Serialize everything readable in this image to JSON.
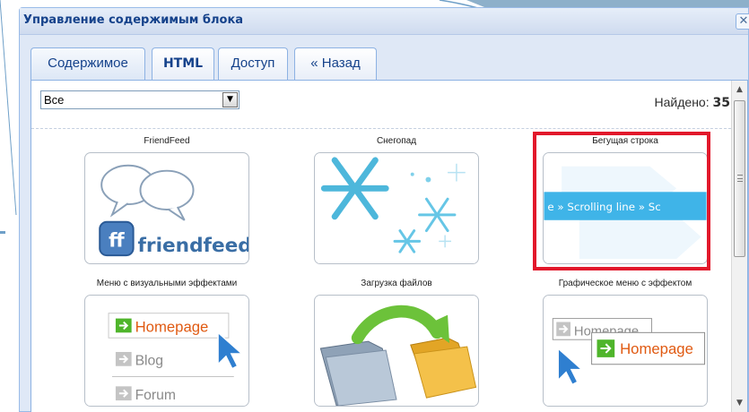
{
  "window": {
    "title": "Управление содержимым блока",
    "close_glyph": "✕"
  },
  "tabs": [
    {
      "label": "Содержимое",
      "active": true
    },
    {
      "label": "HTML",
      "active": false
    },
    {
      "label": "Доступ",
      "active": false
    },
    {
      "label": "« Назад",
      "active": false
    }
  ],
  "filter": {
    "selected": "Все",
    "dropdown_glyph": "▼"
  },
  "found": {
    "label": "Найдено:",
    "count": "35"
  },
  "scrollbar": {
    "up_glyph": "▲",
    "down_glyph": "▼"
  },
  "tiles": [
    {
      "label": "FriendFeed",
      "image_text": "friendfeed",
      "icon": "friendfeed-logo-icon"
    },
    {
      "label": "Снегопад",
      "icon": "snowflakes-icon"
    },
    {
      "label": "Бегущая строка",
      "image_text": "e » Scrolling line » Sc",
      "icon": "scrolling-line-icon",
      "highlighted": true
    },
    {
      "label": "Меню с визуальными эффектами",
      "items": [
        "Homepage",
        "Blog",
        "Forum"
      ],
      "icon": "visual-menu-icon"
    },
    {
      "label": "Загрузка файлов",
      "icon": "folder-upload-icon"
    },
    {
      "label": "Графическое меню с эффектом",
      "items": [
        "Homepage",
        "Homepage"
      ],
      "icon": "graphic-menu-icon"
    }
  ],
  "colors": {
    "accent": "#15428b",
    "panel_border": "#8db2e3",
    "highlight": "#e2182b",
    "menu_green": "#4fb52b",
    "friendfeed_blue": "#3a6ea5"
  }
}
